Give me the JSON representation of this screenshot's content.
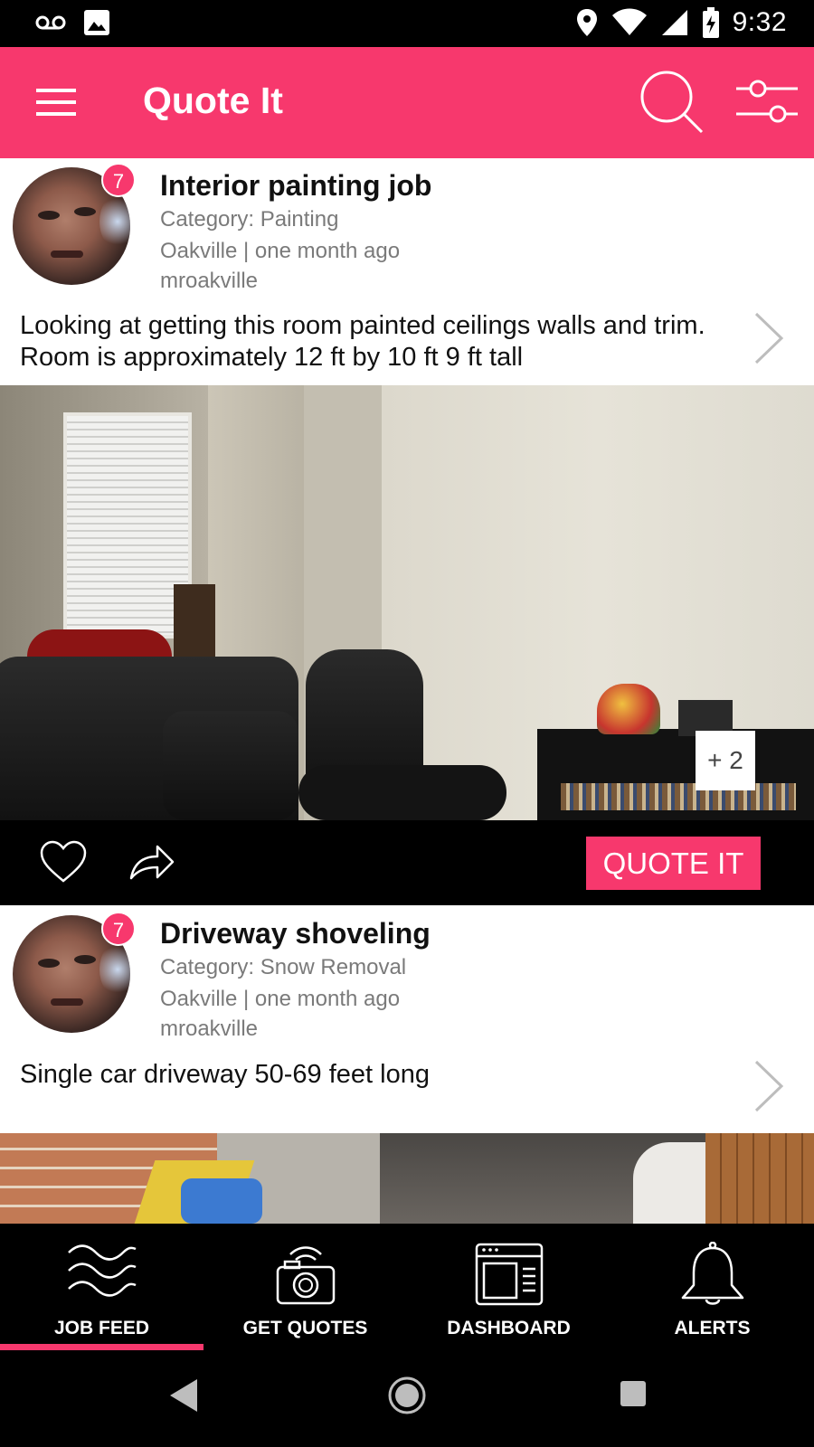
{
  "status_bar": {
    "time": "9:32",
    "left_icons": [
      "voicemail-icon",
      "image-icon"
    ],
    "right_icons": [
      "location-icon",
      "wifi-icon",
      "signal-icon",
      "battery-charging-icon"
    ]
  },
  "app_bar": {
    "title": "Quote It",
    "color": "#f7386d",
    "icons": [
      "menu-icon",
      "search-icon",
      "filter-sliders-icon"
    ]
  },
  "posts": [
    {
      "title": "Interior painting job",
      "category": "Category: Painting",
      "location_time": " Oakville |  one month ago",
      "user": "mroakville",
      "badge_count": "7",
      "description": "Looking at getting this room painted ceilings walls and trim. Room is approximately 12 ft by 10 ft 9 ft tall",
      "extra_photos": "+ 2",
      "quote_button": "QUOTE IT"
    },
    {
      "title": "Driveway shoveling",
      "category": "Category: Snow Removal",
      "location_time": " Oakville |  one month ago",
      "user": "mroakville",
      "badge_count": "7",
      "description": "Single car driveway 50-69 feet long"
    }
  ],
  "bottom_nav": {
    "items": [
      {
        "label": "JOB FEED",
        "icon": "waves-icon",
        "active": true
      },
      {
        "label": "GET QUOTES",
        "icon": "camera-icon",
        "active": false
      },
      {
        "label": "DASHBOARD",
        "icon": "dashboard-icon",
        "active": false
      },
      {
        "label": "ALERTS",
        "icon": "bell-icon",
        "active": false
      }
    ]
  },
  "system_nav": {
    "icons": [
      "back-icon",
      "home-icon",
      "recents-icon"
    ]
  }
}
